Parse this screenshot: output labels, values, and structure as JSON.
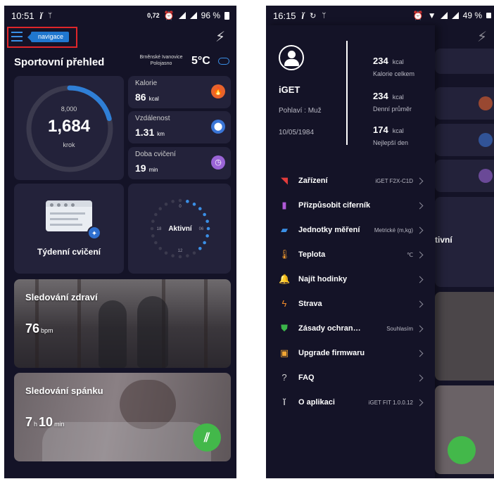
{
  "left": {
    "status": {
      "time": "10:51",
      "battery": "96 %",
      "speed": "0,72"
    },
    "nav_tag": "navigace",
    "title": "Sportovní přehled",
    "weather": {
      "location": "Brněnské Ivanovice",
      "condition": "Polojasno",
      "temp": "5°C"
    },
    "steps": {
      "goal": "8,000",
      "value": "1,684",
      "unit": "krok",
      "progress": 0.21
    },
    "calories": {
      "label": "Kalorie",
      "value": "86",
      "unit": "kcal"
    },
    "distance": {
      "label": "Vzdálenost",
      "value": "1.31",
      "unit": "km"
    },
    "exercise": {
      "label": "Doba cvičení",
      "value": "19",
      "unit": "min"
    },
    "weekly": {
      "label": "Týdenní cvičení"
    },
    "active": {
      "label": "Aktivní",
      "t0": "0",
      "t6": "06",
      "t12": "12",
      "t18": "18"
    },
    "health": {
      "title": "Sledování zdraví",
      "value": "76",
      "unit": "bpm"
    },
    "sleep": {
      "title": "Sledování spánku",
      "hours": "7",
      "h_unit": "h",
      "minutes": "10",
      "m_unit": "min"
    }
  },
  "right": {
    "status": {
      "time": "16:15",
      "battery": "49 %"
    },
    "profile": {
      "name": "iGET",
      "gender": "Pohlaví : Muž",
      "birthdate": "10/05/1984"
    },
    "kpis": [
      {
        "value": "234",
        "unit": "kcal",
        "caption": "Kalorie celkem"
      },
      {
        "value": "234",
        "unit": "kcal",
        "caption": "Denní průměr"
      },
      {
        "value": "174",
        "unit": "kcal",
        "caption": "Nejlepší den"
      }
    ],
    "menu": [
      {
        "label": "Zařízení",
        "value": "iGET F2X-C1D",
        "icon": "signal-icon",
        "color": "#e23b3b"
      },
      {
        "label": "Přizpůsobit ciferník",
        "value": "",
        "icon": "watch-icon",
        "color": "#b05ad8"
      },
      {
        "label": "Jednotky měření",
        "value": "Metrické (m,kg)",
        "icon": "ruler-icon",
        "color": "#3a8fe6"
      },
      {
        "label": "Teplota",
        "value": "℃",
        "icon": "thermometer-icon",
        "color": "#f29a2e"
      },
      {
        "label": "Najít hodinky",
        "value": "",
        "icon": "bell-icon",
        "color": "#e64a8a"
      },
      {
        "label": "Strava",
        "value": "",
        "icon": "pulse-icon",
        "color": "#f08a2a"
      },
      {
        "label": "Zásady ochran…",
        "value": "Souhlasím",
        "icon": "shield-icon",
        "color": "#3bb54a"
      },
      {
        "label": "Upgrade firmwaru",
        "value": "",
        "icon": "firmware-icon",
        "color": "#f2a634"
      },
      {
        "label": "FAQ",
        "value": "",
        "icon": "question-icon",
        "color": "#cfcfcf"
      },
      {
        "label": "O aplikaci",
        "value": "iGET FIT 1.0.0.12",
        "icon": "info-icon",
        "color": "#ffffff"
      }
    ],
    "bg_active": "tivní"
  },
  "colors": {
    "bg": "#141327",
    "card": "#23223a",
    "accent": "#3a8fe6",
    "highlight": "#e0262a",
    "fab": "#43b84a"
  }
}
